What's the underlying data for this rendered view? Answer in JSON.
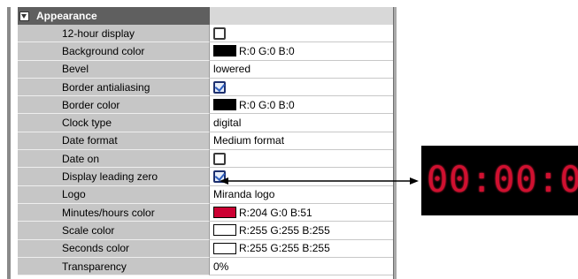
{
  "section": {
    "title": "Appearance"
  },
  "rows": [
    {
      "label": "12-hour display",
      "type": "checkbox",
      "checked": false
    },
    {
      "label": "Background color",
      "type": "color",
      "color": "#000000",
      "text": "R:0 G:0 B:0"
    },
    {
      "label": "Bevel",
      "type": "text",
      "text": "lowered"
    },
    {
      "label": "Border antialiasing",
      "type": "checkbox",
      "checked": true
    },
    {
      "label": "Border color",
      "type": "color",
      "color": "#000000",
      "text": "R:0 G:0 B:0"
    },
    {
      "label": "Clock type",
      "type": "text",
      "text": "digital"
    },
    {
      "label": "Date format",
      "type": "text",
      "text": "Medium format"
    },
    {
      "label": "Date on",
      "type": "checkbox",
      "checked": false
    },
    {
      "label": "Display leading zero",
      "type": "checkbox",
      "checked": true
    },
    {
      "label": "Logo",
      "type": "text",
      "text": "Miranda logo"
    },
    {
      "label": "Minutes/hours color",
      "type": "color",
      "color": "#cc0033",
      "text": "R:204 G:0 B:51"
    },
    {
      "label": "Scale color",
      "type": "color",
      "color": "#ffffff",
      "text": "R:255 G:255 B:255"
    },
    {
      "label": "Seconds color",
      "type": "color",
      "color": "#ffffff",
      "text": "R:255 G:255 B:255"
    },
    {
      "label": "Transparency",
      "type": "text",
      "text": "0%"
    }
  ],
  "clock_preview": {
    "display": "00:00:00",
    "color": "#d01030"
  }
}
